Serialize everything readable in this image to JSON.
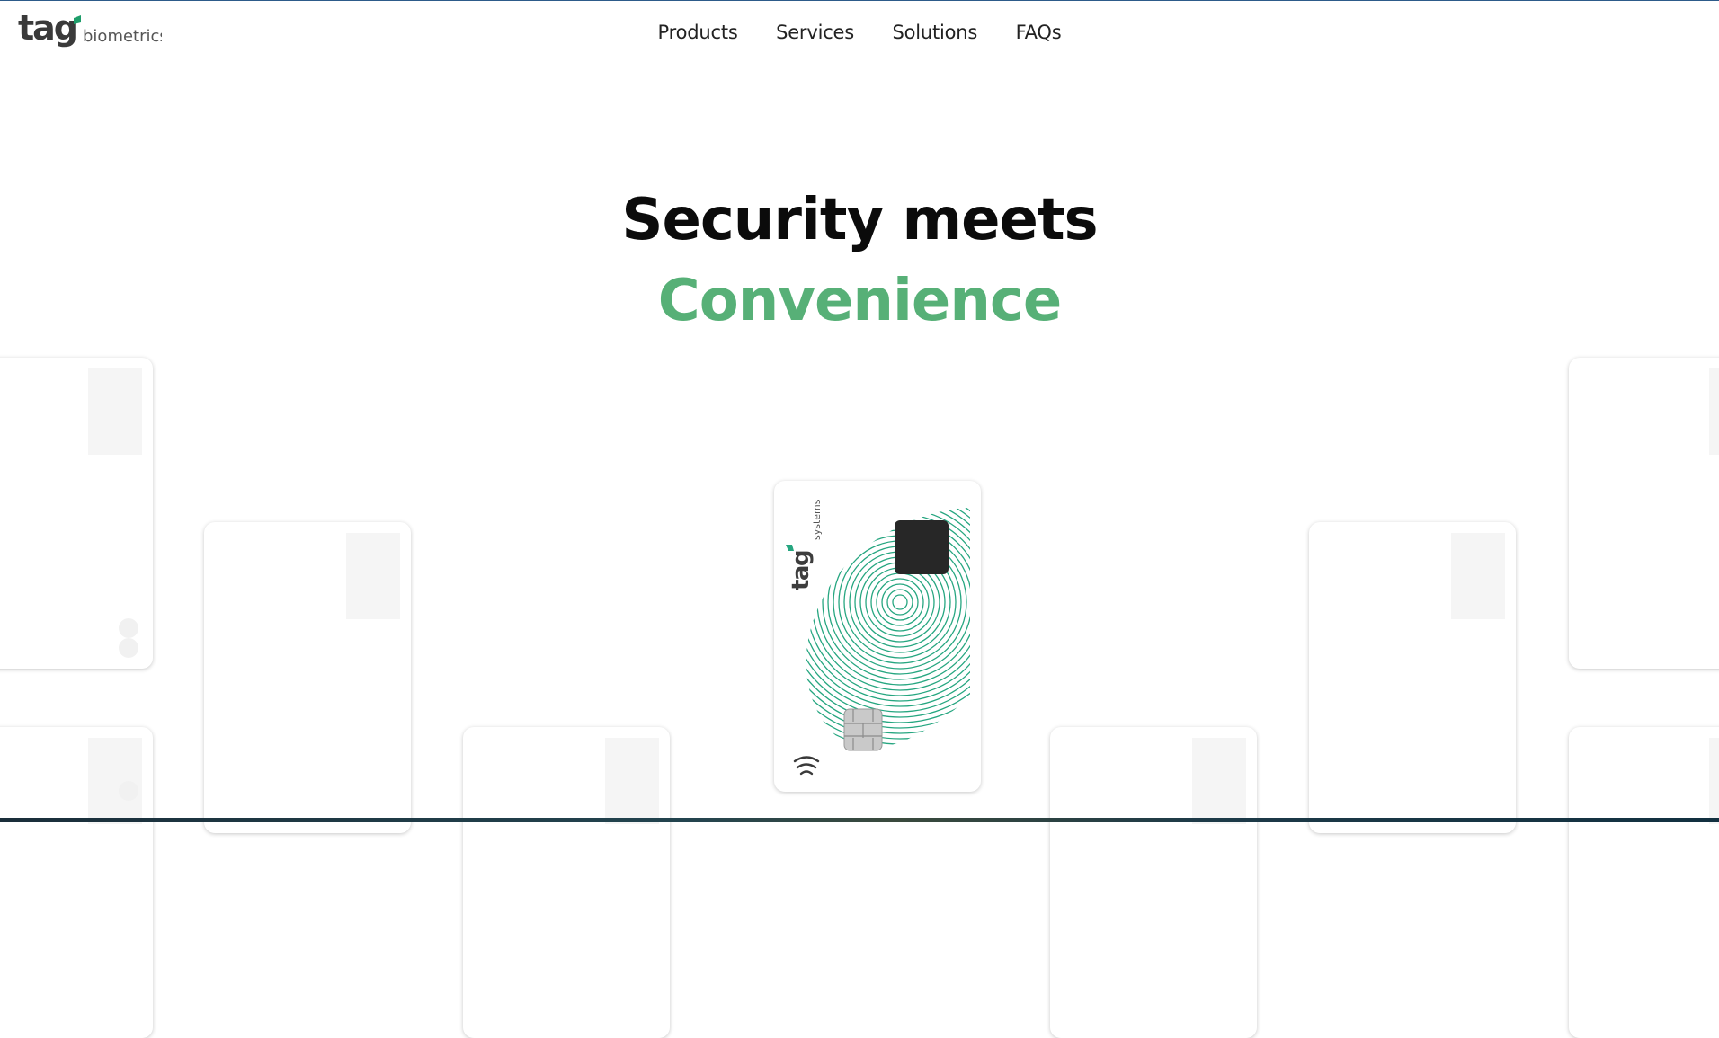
{
  "brand": {
    "logo_mark": "tag",
    "logo_text": "biometrics",
    "accent_color": "#1e9d6a"
  },
  "nav": {
    "items": [
      {
        "label": "Products"
      },
      {
        "label": "Services"
      },
      {
        "label": "Solutions"
      },
      {
        "label": "FAQs"
      }
    ]
  },
  "hero": {
    "line1": "Security meets",
    "line2": "Convenience",
    "line2_color": "#57b077"
  },
  "featured_card": {
    "brand": "tag",
    "sub_brand": "systems",
    "pattern_color": "#26a680",
    "icons": [
      "fingerprint-sensor-icon",
      "chip-icon",
      "contactless-icon",
      "fingerprint-pattern-icon"
    ]
  }
}
